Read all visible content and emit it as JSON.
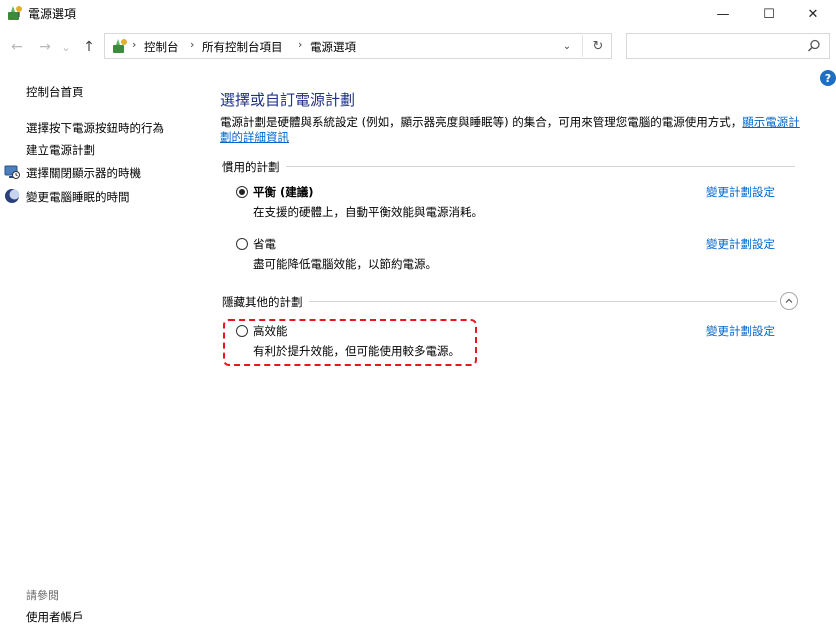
{
  "window": {
    "title": "電源選項",
    "minimize_glyph": "—",
    "maximize_glyph": "☐",
    "close_glyph": "✕"
  },
  "nav": {
    "back_glyph": "←",
    "forward_glyph": "→",
    "recent_glyph": "⌄",
    "up_glyph": "↑"
  },
  "breadcrumb": {
    "items": [
      "控制台",
      "所有控制台項目",
      "電源選項"
    ],
    "separator": "›",
    "dropdown_glyph": "⌄",
    "refresh_glyph": "↻"
  },
  "search": {
    "placeholder": ""
  },
  "help_glyph": "?",
  "sidebar": {
    "home": "控制台首頁",
    "links": [
      {
        "label": "選擇按下電源按鈕時的行為",
        "icon": "none"
      },
      {
        "label": "建立電源計劃",
        "icon": "none"
      },
      {
        "label": "選擇關閉顯示器的時機",
        "icon": "monitor-power-icon"
      },
      {
        "label": "變更電腦睡眠的時間",
        "icon": "moon-sleep-icon"
      }
    ],
    "see_also_label": "請參閱",
    "see_also_links": [
      "使用者帳戶"
    ]
  },
  "main": {
    "title": "選擇或自訂電源計劃",
    "description": "電源計劃是硬體與系統設定 (例如，顯示器亮度與睡眠等) 的集合，可用來管理您電腦的電源使用方式，",
    "description_link": "顯示電源計劃的詳細資訊",
    "preferred_section_label": "慣用的計劃",
    "hidden_section_label": "隱藏其他的計劃",
    "collapse_glyph": "⌃",
    "plans": [
      {
        "name": "平衡 (建議)",
        "desc": "在支援的硬體上，自動平衡效能與電源消耗。",
        "selected": true,
        "change_label": "變更計劃設定"
      },
      {
        "name": "省電",
        "desc": "盡可能降低電腦效能，以節約電源。",
        "selected": false,
        "change_label": "變更計劃設定"
      },
      {
        "name": "高效能",
        "desc": "有利於提升效能，但可能使用較多電源。",
        "selected": false,
        "change_label": "變更計劃設定"
      }
    ]
  },
  "colors": {
    "title": "#1e3287",
    "link": "#0066cc",
    "highlight": "#e8151f"
  }
}
